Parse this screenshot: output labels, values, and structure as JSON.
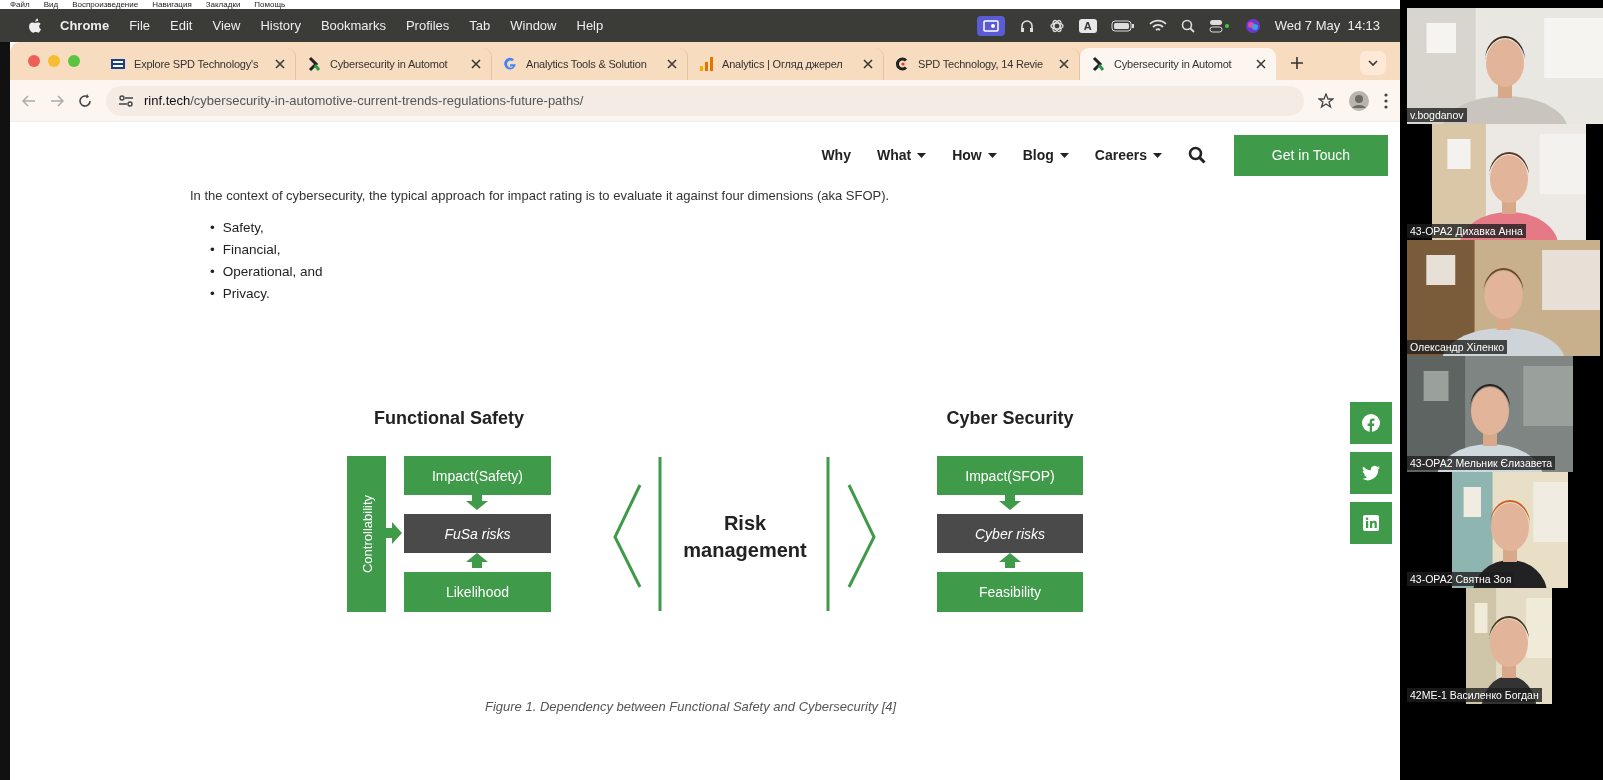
{
  "top_menu": [
    "Файл",
    "Вид",
    "Воспроизведение",
    "Навигация",
    "Закладки",
    "Помощь"
  ],
  "menu_bar": {
    "app": "Chrome",
    "items": [
      "File",
      "Edit",
      "View",
      "History",
      "Bookmarks",
      "Profiles",
      "Tab",
      "Window",
      "Help"
    ],
    "input_source": "A",
    "clock": "Wed 7 May  14:13"
  },
  "tabs": [
    {
      "title": "Explore SPD Technology's",
      "kind": "flag",
      "selected": false
    },
    {
      "title": "Cybersecurity in Automot",
      "kind": "rinf",
      "selected": false
    },
    {
      "title": "Analytics Tools & Solution",
      "kind": "google",
      "selected": false
    },
    {
      "title": "Analytics | Огляд джерел",
      "kind": "analytics",
      "selected": false
    },
    {
      "title": "SPD Technology, 14 Revie",
      "kind": "clutch",
      "selected": false
    },
    {
      "title": "Cybersecurity in Automot",
      "kind": "rinf",
      "selected": true
    }
  ],
  "address_bar": {
    "host": "rinf.tech",
    "path": "/cybersecurity-in-automotive-current-trends-regulations-future-paths/"
  },
  "site_nav": {
    "items": [
      {
        "label": "Why",
        "dropdown": false
      },
      {
        "label": "What",
        "dropdown": true
      },
      {
        "label": "How",
        "dropdown": true
      },
      {
        "label": "Blog",
        "dropdown": true
      },
      {
        "label": "Careers",
        "dropdown": true
      }
    ],
    "cta": "Get in Touch"
  },
  "article": {
    "intro": "In the context of cybersecurity, the typical approach for impact rating is to evaluate it against four dimensions (aka SFOP).",
    "bullet_marker": "•",
    "bullets": [
      "Safety,",
      "Financial,",
      "Operational, and",
      "Privacy."
    ],
    "figure": {
      "left_title": "Functional Safety",
      "right_title": "Cyber Security",
      "controllability": "Controllability",
      "left_boxes": [
        "Impact(Safety)",
        "FuSa risks",
        "Likelihood"
      ],
      "center": [
        "Risk",
        "management"
      ],
      "right_boxes": [
        "Impact(SFOP)",
        "Cyber risks",
        "Feasibility"
      ]
    },
    "caption": "Figure 1. Dependency between Functional Safety and Cybersecurity [4]"
  },
  "share_buttons": [
    {
      "kind": "facebook"
    },
    {
      "kind": "twitter"
    },
    {
      "kind": "linkedin"
    }
  ],
  "video_tiles": [
    {
      "name": "v.bogdanov"
    },
    {
      "name": "43-ОРА2 Дихавка Анна"
    },
    {
      "name": "Олександр Хіленко"
    },
    {
      "name": "43-ОРА2 Мельник Єлизавета"
    },
    {
      "name": "43-ОРА2 Святна Зоя"
    },
    {
      "name": "42МЕ-1 Василенко Богдан"
    }
  ]
}
